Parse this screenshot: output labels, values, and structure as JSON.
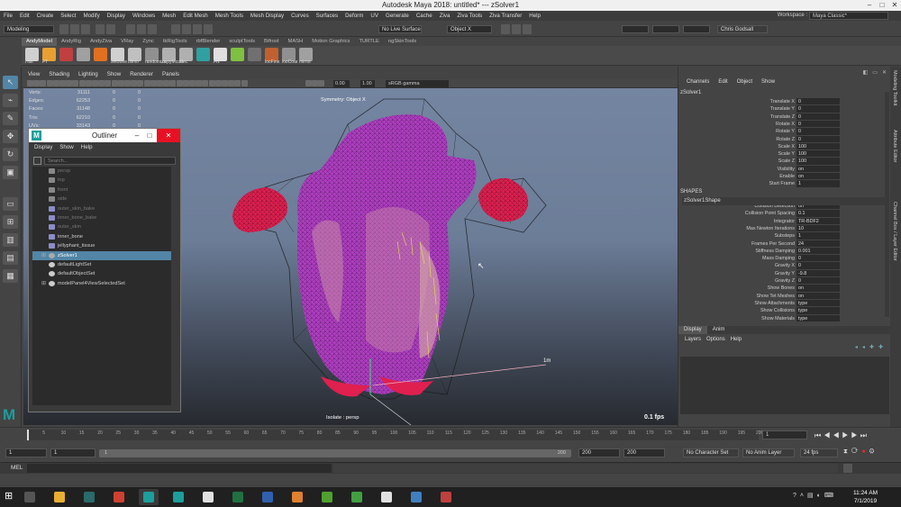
{
  "window": {
    "title": "Autodesk Maya 2018: untitled*   ---   zSolver1"
  },
  "menubar": [
    "File",
    "Edit",
    "Create",
    "Select",
    "Modify",
    "Display",
    "Windows",
    "Mesh",
    "Edit Mesh",
    "Mesh Tools",
    "Mesh Display",
    "Curves",
    "Surfaces",
    "Deform",
    "UV",
    "Generate",
    "Cache",
    "Ziva",
    "Ziva Tools",
    "Ziva Transfer",
    "Help"
  ],
  "workspace": {
    "label": "Workspace :",
    "value": "Maya Classic*"
  },
  "statusline": {
    "mode": "Modeling",
    "live_surface": "No Live Surface",
    "object_mode": "Object X",
    "user": "Chris Godsall"
  },
  "shelf_tabs": [
    "AndyModel",
    "AndyRig",
    "AndyZiva",
    "VRay",
    "Zync",
    "tkRigTools",
    "rbfBlender",
    "sculptTools",
    "Bifrost",
    "MASH",
    "Motion Graphics",
    "TURTLE",
    "ngSkinTools"
  ],
  "shelf_buttons": [
    "Hist",
    "FT",
    "",
    "",
    "",
    "selBone",
    "blimo",
    "randomize",
    "copyMcom",
    "Mec",
    "",
    "FN",
    "",
    "",
    "looFine",
    "looCoar",
    "mirror"
  ],
  "panel_menu": [
    "View",
    "Shading",
    "Lighting",
    "Show",
    "Renderer",
    "Panels"
  ],
  "panel_tools": {
    "gamma": "sRGB gamma",
    "exposure": "0.00",
    "gamma_value": "1.00"
  },
  "hud": [
    {
      "label": "Verts:",
      "a": "31111",
      "b": "0",
      "c": "0"
    },
    {
      "label": "Edges:",
      "a": "62253",
      "b": "0",
      "c": "0"
    },
    {
      "label": "Faces:",
      "a": "31148",
      "b": "0",
      "c": "0"
    },
    {
      "label": "Tris:",
      "a": "62210",
      "b": "0",
      "c": "0"
    },
    {
      "label": "UVs:",
      "a": "33143",
      "b": "0",
      "c": "0"
    }
  ],
  "viewport": {
    "symmetry": "Symmetry: Object X",
    "isolate": "Isolate : persp",
    "fps": "0.1 fps",
    "measure": "1m"
  },
  "outliner": {
    "title": "Outliner",
    "menu": [
      "Display",
      "Show",
      "Help"
    ],
    "search_placeholder": "Search...",
    "items": [
      {
        "name": "persp",
        "dim": true,
        "icon": "camera"
      },
      {
        "name": "top",
        "dim": true,
        "icon": "camera"
      },
      {
        "name": "front",
        "dim": true,
        "icon": "camera"
      },
      {
        "name": "side",
        "dim": true,
        "icon": "camera"
      },
      {
        "name": "outer_skin_bake",
        "dim": true,
        "icon": "mesh"
      },
      {
        "name": "inner_bone_bake",
        "dim": true,
        "icon": "mesh"
      },
      {
        "name": "outer_skin",
        "dim": true,
        "icon": "mesh"
      },
      {
        "name": "inner_bone",
        "dim": false,
        "icon": "mesh"
      },
      {
        "name": "jellyphant_tissue",
        "dim": false,
        "icon": "mesh"
      },
      {
        "name": "zSolver1",
        "dim": false,
        "icon": "solver",
        "selected": true,
        "expand": true
      },
      {
        "name": "defaultLightSet",
        "dim": false,
        "icon": "set"
      },
      {
        "name": "defaultObjectSet",
        "dim": false,
        "icon": "set"
      },
      {
        "name": "modelPanel4ViewSelectedSet",
        "dim": false,
        "icon": "set",
        "expand": true
      }
    ]
  },
  "channelbox": {
    "menu": [
      "Channels",
      "Edit",
      "Object",
      "Show"
    ],
    "object": "zSolver1",
    "transform": [
      {
        "n": "Translate X",
        "v": "0"
      },
      {
        "n": "Translate Y",
        "v": "0"
      },
      {
        "n": "Translate Z",
        "v": "0"
      },
      {
        "n": "Rotate X",
        "v": "0"
      },
      {
        "n": "Rotate Y",
        "v": "0"
      },
      {
        "n": "Rotate Z",
        "v": "0"
      },
      {
        "n": "Scale X",
        "v": "100"
      },
      {
        "n": "Scale Y",
        "v": "100"
      },
      {
        "n": "Scale Z",
        "v": "100"
      },
      {
        "n": "Visibility",
        "v": "on"
      },
      {
        "n": "Enable",
        "v": "on"
      },
      {
        "n": "Start Frame",
        "v": "1"
      }
    ],
    "shapes_header": "SHAPES",
    "shape_name": "zSolver1Shape",
    "shape_attrs": [
      {
        "n": "Collision Detection",
        "v": "on"
      },
      {
        "n": "Collision Point Spacing",
        "v": "0.1"
      },
      {
        "n": "Integrator",
        "v": "TR-BDF2"
      },
      {
        "n": "Max Newton Iterations",
        "v": "10"
      },
      {
        "n": "Substeps",
        "v": "1"
      },
      {
        "n": "Frames Per Second",
        "v": "24"
      },
      {
        "n": "Stiffness Damping",
        "v": "0.001"
      },
      {
        "n": "Mass Damping",
        "v": "0"
      },
      {
        "n": "Gravity X",
        "v": "0"
      },
      {
        "n": "Gravity Y",
        "v": "-9.8"
      },
      {
        "n": "Gravity Z",
        "v": "0"
      },
      {
        "n": "Show Bones",
        "v": "on"
      },
      {
        "n": "Show Tet Meshes",
        "v": "on"
      },
      {
        "n": "Show Attachments",
        "v": "type"
      },
      {
        "n": "Show Collisions",
        "v": "type"
      },
      {
        "n": "Show Materials",
        "v": "type"
      }
    ],
    "display_tabs": [
      "Display",
      "Anim"
    ],
    "layer_menu": [
      "Layers",
      "Options",
      "Help"
    ]
  },
  "side_tabs": [
    "Modeling Toolkit",
    "Attribute Editor",
    "Channel Box / Layer Editor"
  ],
  "timeline": {
    "current": "1",
    "ticks": [
      "5",
      "10",
      "15",
      "20",
      "25",
      "30",
      "35",
      "40",
      "45",
      "50",
      "55",
      "60",
      "65",
      "70",
      "75",
      "80",
      "85",
      "90",
      "95",
      "100",
      "105",
      "110",
      "115",
      "120",
      "125",
      "130",
      "135",
      "140",
      "145",
      "150",
      "155",
      "160",
      "165",
      "170",
      "175",
      "180",
      "185",
      "190",
      "195",
      "200"
    ]
  },
  "range": {
    "start": "1",
    "start2": "1",
    "slider_start": "1",
    "slider_end": "200",
    "end": "200",
    "end2": "200",
    "char_set": "No Character Set",
    "anim_layer": "No Anim Layer",
    "fps": "24 fps"
  },
  "cmd": {
    "mel": "MEL"
  },
  "taskbar": {
    "time": "11:24 AM",
    "date": "7/1/2019"
  },
  "colors": {
    "maya_teal": "#1b9e9c",
    "selection": "#5285a6",
    "mesh_purple": "#b23fc4",
    "hands_red": "#e0204f"
  }
}
